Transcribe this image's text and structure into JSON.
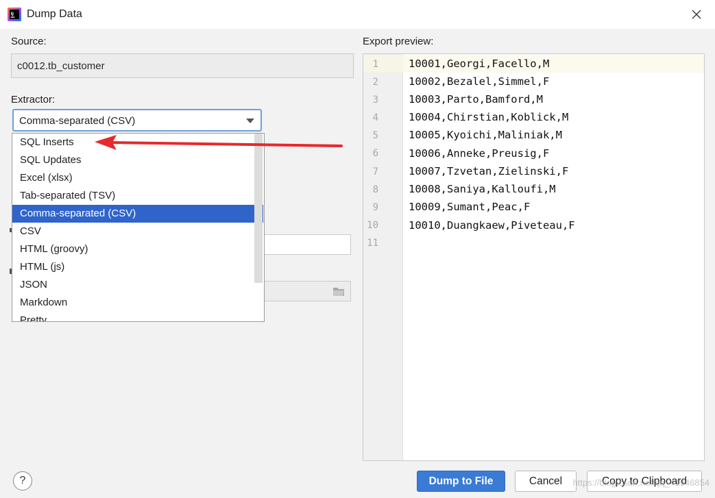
{
  "window": {
    "title": "Dump Data",
    "icon": "intellij-app-icon"
  },
  "source": {
    "label": "Source:",
    "value": "c0012.tb_customer"
  },
  "extractor": {
    "label": "Extractor:",
    "selected": "Comma-separated (CSV)",
    "options": [
      "SQL Inserts",
      "SQL Updates",
      "Excel (xlsx)",
      "Tab-separated (TSV)",
      "Comma-separated (CSV)",
      "CSV",
      "HTML (groovy)",
      "HTML (js)",
      "JSON",
      "Markdown",
      "Pretty"
    ],
    "highlighted_index": 4
  },
  "preview": {
    "label": "Export preview:",
    "line_numbers": [
      "1",
      "2",
      "3",
      "4",
      "5",
      "6",
      "7",
      "8",
      "9",
      "10",
      "11"
    ],
    "lines": [
      "10001,Georgi,Facello,M",
      "10002,Bezalel,Simmel,F",
      "10003,Parto,Bamford,M",
      "10004,Chirstian,Koblick,M",
      "10005,Kyoichi,Maliniak,M",
      "10006,Anneke,Preusig,F",
      "10007,Tzvetan,Zielinski,F",
      "10008,Saniya,Kalloufi,M",
      "10009,Sumant,Peac,F",
      "10010,Duangkaew,Piveteau,F",
      ""
    ]
  },
  "buttons": {
    "help": "?",
    "dump_to_file": "Dump to File",
    "cancel": "Cancel",
    "copy_to_clipboard": "Copy to Clipboard"
  },
  "annotation": {
    "arrow_color": "#e8282b"
  },
  "colors": {
    "primary_button": "#3a7bd5",
    "selection": "#2f65ca",
    "focus_border": "#6e9fdb"
  },
  "watermark": "https://blog.csdn.net/qq_41946854"
}
